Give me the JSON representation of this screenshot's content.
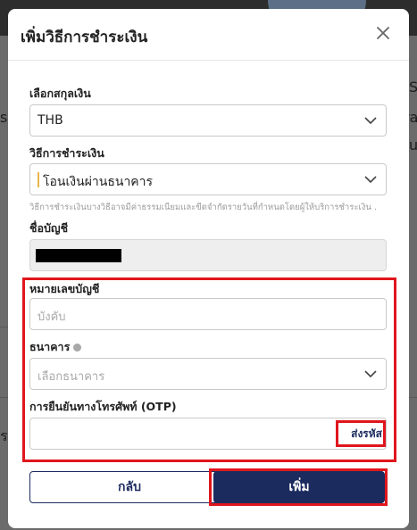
{
  "background": {
    "fragments": [
      "S",
      "s",
      "ra",
      "u",
      "ร"
    ]
  },
  "modal": {
    "title": "เพิ่มวิธีการชำระเงิน",
    "close_icon": "close-icon"
  },
  "currency": {
    "label": "เลือกสกุลเงิน",
    "value": "THB"
  },
  "payment_method": {
    "label": "วิธีการชำระเงิน",
    "value": "โอนเงินผ่านธนาคาร",
    "help": "วิธีการชำระเงินบางวิธีอาจมีค่าธรรมเนียมและขีดจำกัดรายวันที่กำหนดโดยผู้ให้บริการชำระเงิน ."
  },
  "account_name": {
    "label": "ชื่อบัญชี"
  },
  "account_number": {
    "label": "หมายเลขบัญชี",
    "placeholder": "บังคับ"
  },
  "bank": {
    "label": "ธนาคาร",
    "placeholder": "เลือกธนาคาร"
  },
  "otp": {
    "label": "การยืนยันทางโทรศัพท์ (OTP)",
    "send_code": "ส่งรหัส"
  },
  "buttons": {
    "back": "กลับ",
    "add": "เพิ่ม"
  },
  "colors": {
    "primary": "#1c2b5e",
    "highlight": "#e0161d",
    "caret": "#e8b64a"
  }
}
